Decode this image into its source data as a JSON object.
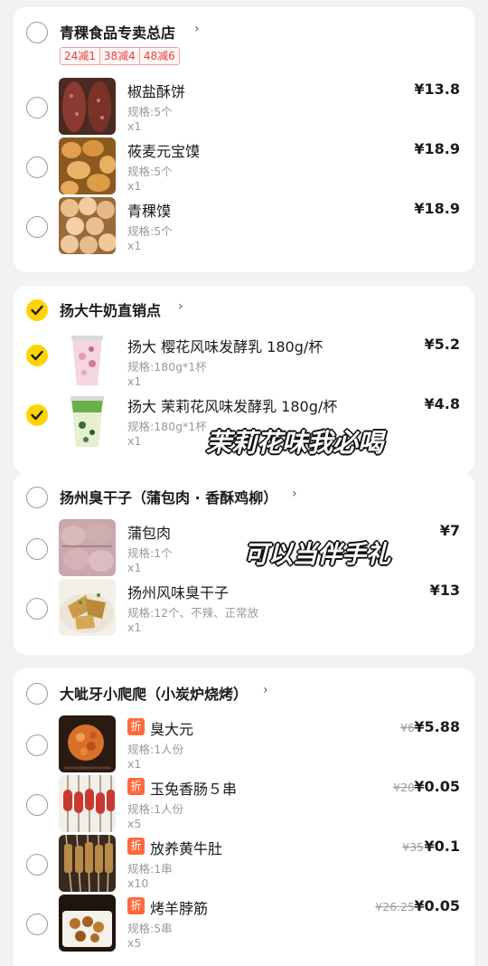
{
  "stores": [
    {
      "name": "青稞食品专卖总店",
      "checked": false,
      "promos": [
        "24减1",
        "38减4",
        "48减6"
      ],
      "items": [
        {
          "name": "椒盐酥饼",
          "spec": "规格:5个",
          "qty": "x1",
          "price": "¥13.8"
        },
        {
          "name": "莜麦元宝馍",
          "spec": "规格:5个",
          "qty": "x1",
          "price": "¥18.9"
        },
        {
          "name": "青稞馍",
          "spec": "规格:5个",
          "qty": "x1",
          "price": "¥18.9"
        }
      ]
    },
    {
      "name": "扬大牛奶直销点",
      "checked": true,
      "items": [
        {
          "name": "扬大 樱花风味发酵乳 180g/杯",
          "spec": "规格:180g*1杯",
          "qty": "x1",
          "price": "¥5.2"
        },
        {
          "name": "扬大 茉莉花风味发酵乳 180g/杯",
          "spec": "规格:180g*1杯",
          "qty": "x1",
          "price": "¥4.8"
        }
      ]
    },
    {
      "name": "扬州臭干子（蒲包肉 · 香酥鸡柳）",
      "checked": false,
      "items": [
        {
          "name": "蒲包肉",
          "spec": "规格:1个",
          "qty": "x1",
          "price": "¥7"
        },
        {
          "name": "扬州风味臭干子",
          "spec": "规格:12个、不辣、正常放",
          "qty": "x1",
          "price": "¥13"
        }
      ]
    },
    {
      "name": "大呲牙小爬爬（小炭炉烧烤）",
      "checked": false,
      "items": [
        {
          "name": "臭大元",
          "badge": "折",
          "spec": "规格:1人份",
          "qty": "x1",
          "original_price": "¥6",
          "price": "¥5.88"
        },
        {
          "name": "玉兔香肠５串",
          "badge": "折",
          "spec": "规格:1人份",
          "qty": "x5",
          "original_price": "¥20",
          "price": "¥0.05"
        },
        {
          "name": "放养黄牛肚",
          "badge": "折",
          "spec": "规格:1串",
          "qty": "x10",
          "original_price": "¥35",
          "price": "¥0.1"
        },
        {
          "name": "烤羊脖筋",
          "badge": "折",
          "spec": "规格:5串",
          "qty": "x5",
          "original_price": "¥26.25",
          "price": "¥0.05"
        }
      ]
    }
  ],
  "overlays": {
    "jasmine": "茉莉花味我必喝",
    "gift": "可以当伴手礼"
  },
  "colors": {
    "checked": "#ffd400",
    "discount_badge": "#ff6a3d",
    "promo_text": "#e64040",
    "background": "#f2f2f2"
  }
}
